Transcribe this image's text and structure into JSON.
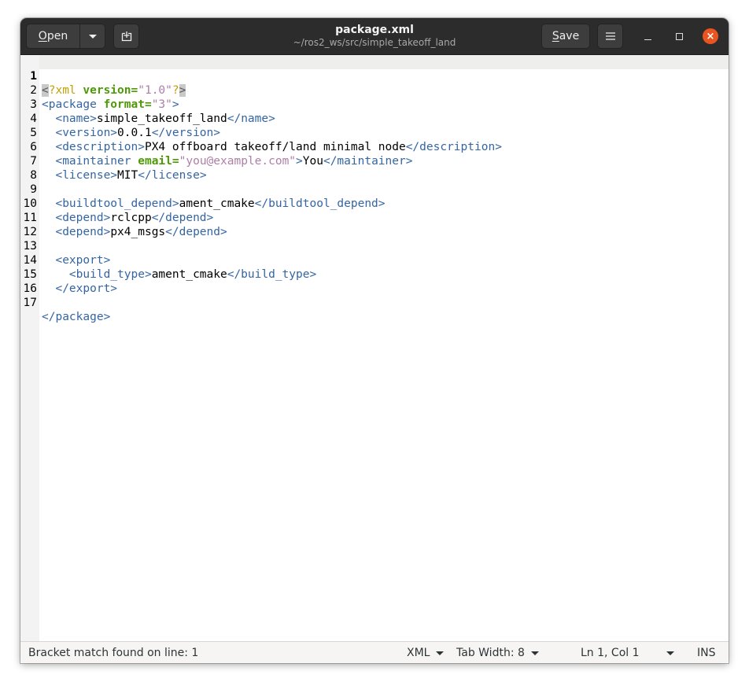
{
  "window": {
    "title": "package.xml",
    "subtitle": "~/ros2_ws/src/simple_takeoff_land"
  },
  "headerbar": {
    "open_label_underlined": "O",
    "open_label_rest": "pen",
    "save_label_underlined": "S",
    "save_label_rest": "ave",
    "icons": [
      "dropdown-arrow-icon",
      "new-tab-icon",
      "hamburger-menu-icon",
      "minimize-icon",
      "maximize-icon",
      "close-icon"
    ]
  },
  "editor": {
    "current_line": 1,
    "line_numbers": [
      "1",
      "2",
      "3",
      "4",
      "5",
      "6",
      "7",
      "8",
      "9",
      "10",
      "11",
      "12",
      "13",
      "14",
      "15",
      "16",
      "17"
    ],
    "lines": [
      "<?xml version=\"1.0\"?>",
      "<package format=\"3\">",
      "  <name>simple_takeoff_land</name>",
      "  <version>0.0.1</version>",
      "  <description>PX4 offboard takeoff/land minimal node</description>",
      "  <maintainer email=\"you@example.com\">You</maintainer>",
      "  <license>MIT</license>",
      "",
      "  <buildtool_depend>ament_cmake</buildtool_depend>",
      "  <depend>rclcpp</depend>",
      "  <depend>px4_msgs</depend>",
      "",
      "  <export>",
      "    <build_type>ament_cmake</build_type>",
      "  </export>",
      "",
      "</package>"
    ]
  },
  "statusbar": {
    "message": "Bracket match found on line: 1",
    "language": "XML",
    "tab_width": "Tab Width: 8",
    "position": "Ln 1, Col 1",
    "mode": "INS"
  },
  "colors": {
    "tag": "#3465a4",
    "attribute": "#4e9a06",
    "string": "#ad7fa8",
    "processing_instruction": "#c4a000",
    "close_button": "#e95420"
  }
}
